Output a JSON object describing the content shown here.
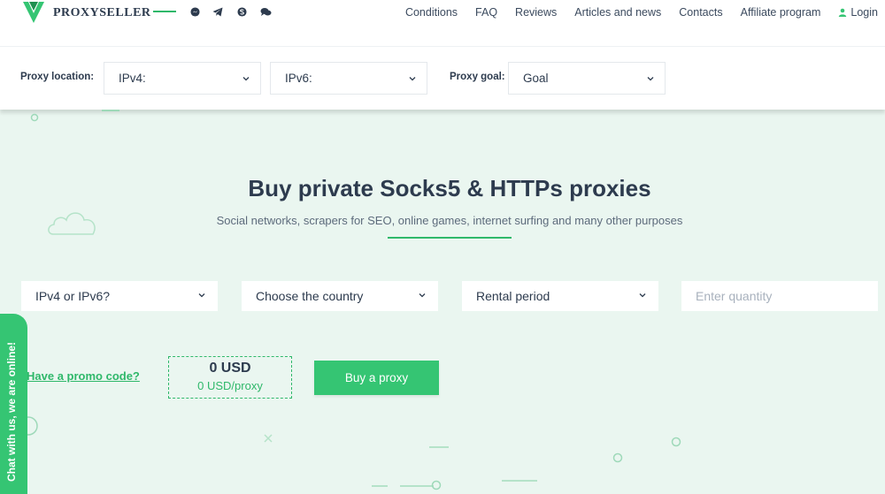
{
  "brand": {
    "name": "PROXYSELLER",
    "accent": "#35c573",
    "text_color": "#2d3b4e"
  },
  "social_icons": [
    "messenger-icon",
    "telegram-icon",
    "skype-icon",
    "chat-bubbles-icon"
  ],
  "nav": {
    "items": [
      "Conditions",
      "FAQ",
      "Reviews",
      "Articles and news",
      "Contacts",
      "Affiliate program"
    ],
    "login": "Login"
  },
  "filters": {
    "location_label": "Proxy location:",
    "ipv4": "IPv4:",
    "ipv6": "IPv6:",
    "goal_label": "Proxy goal:",
    "goal": "Goal"
  },
  "hero": {
    "title": "Buy private Socks5 & HTTPs proxies",
    "subtitle": "Social networks, scrapers for SEO, online games, internet surfing and many other purposes"
  },
  "order": {
    "ip_version": "IPv4 or IPv6?",
    "country": "Choose the country",
    "period": "Rental period",
    "quantity_placeholder": "Enter quantity",
    "promo": "Have a promo code?",
    "total": "0 USD",
    "per_proxy": "0 USD/proxy",
    "buy": "Buy a proxy"
  },
  "chat": {
    "label": "Chat with us, we are online!"
  }
}
